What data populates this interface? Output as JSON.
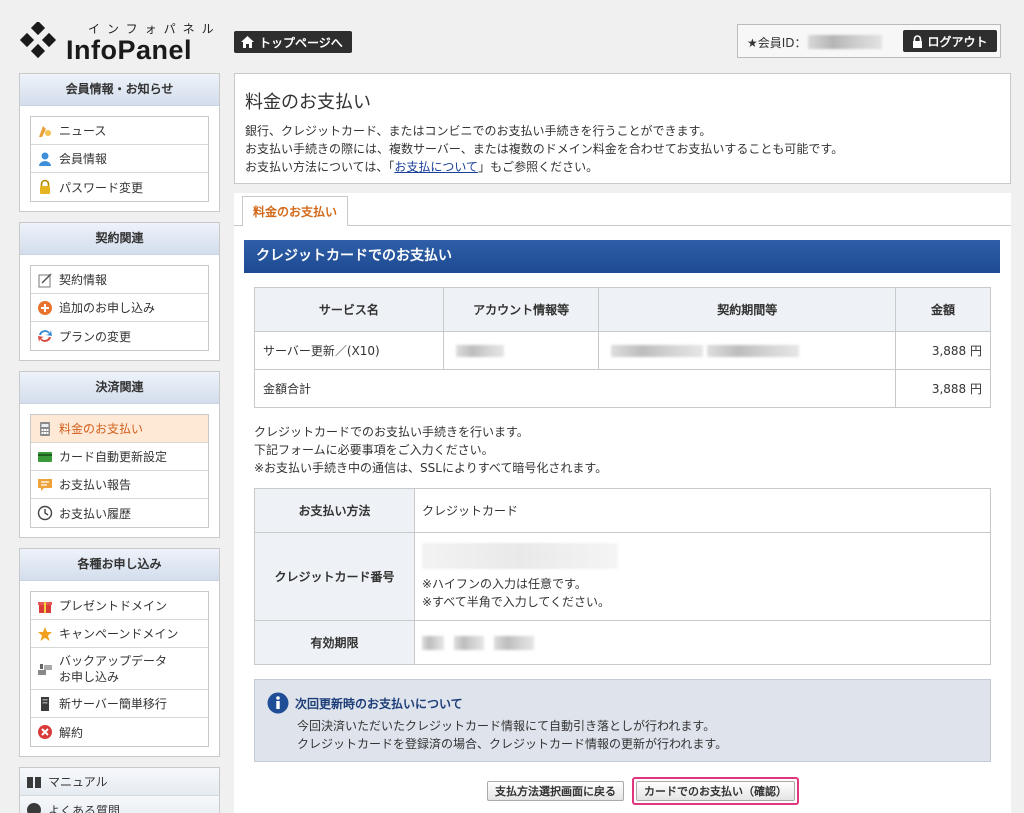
{
  "header": {
    "logo_kana": "インフォパネル",
    "logo_name": "InfoPanel",
    "top_page_button": "トップページへ",
    "member_id_label": "★会員ID：",
    "logout_button": "ログアウト"
  },
  "sidebar": {
    "sections": [
      {
        "title": "会員情報・お知らせ",
        "items": [
          {
            "label": "ニュース",
            "icon": "news-icon"
          },
          {
            "label": "会員情報",
            "icon": "user-icon"
          },
          {
            "label": "パスワード変更",
            "icon": "lock-icon"
          }
        ]
      },
      {
        "title": "契約関連",
        "items": [
          {
            "label": "契約情報",
            "icon": "contract-icon"
          },
          {
            "label": "追加のお申し込み",
            "icon": "add-icon"
          },
          {
            "label": "プランの変更",
            "icon": "change-icon"
          }
        ]
      },
      {
        "title": "決済関連",
        "items": [
          {
            "label": "料金のお支払い",
            "icon": "calculator-icon",
            "active": true
          },
          {
            "label": "カード自動更新設定",
            "icon": "card-icon"
          },
          {
            "label": "お支払い報告",
            "icon": "report-icon"
          },
          {
            "label": "お支払い履歴",
            "icon": "clock-icon"
          }
        ]
      },
      {
        "title": "各種お申し込み",
        "items": [
          {
            "label": "プレゼントドメイン",
            "icon": "gift-icon"
          },
          {
            "label": "キャンペーンドメイン",
            "icon": "star-icon"
          },
          {
            "label": "バックアップデータ お申し込み",
            "icon": "backup-icon"
          },
          {
            "label": "新サーバー簡単移行",
            "icon": "server-icon"
          },
          {
            "label": "解約",
            "icon": "cancel-icon"
          }
        ]
      }
    ],
    "bottom": [
      {
        "label": "マニュアル",
        "icon": "book-icon"
      },
      {
        "label": "よくある質問",
        "icon": "faq-icon"
      }
    ]
  },
  "intro": {
    "title": "料金のお支払い",
    "line1": "銀行、クレジットカード、またはコンビニでのお支払い手続きを行うことができます。",
    "line2": "お支払い手続きの際には、複数サーバー、または複数のドメイン料金を合わせてお支払いすることも可能です。",
    "line3_before": "お支払い方法については、「",
    "line3_link": "お支払について",
    "line3_after": "」もご参照ください。"
  },
  "tab": {
    "label": "料金のお支払い"
  },
  "section_title": "クレジットカードでのお支払い",
  "order_table": {
    "headers": [
      "サービス名",
      "アカウント情報等",
      "契約期間等",
      "金額"
    ],
    "rows": [
      {
        "service": "サーバー更新／(X10)",
        "amount": "3,888 円"
      }
    ],
    "total_label": "金額合計",
    "total_amount": "3,888 円"
  },
  "notes": [
    "クレジットカードでのお支払い手続きを行います。",
    "下記フォームに必要事項をご入力ください。",
    "※お支払い手続き中の通信は、SSLによりすべて暗号化されます。"
  ],
  "form": {
    "method_label": "お支払い方法",
    "method_value": "クレジットカード",
    "card_label": "クレジットカード番号",
    "card_hint1": "※ハイフンの入力は任意です。",
    "card_hint2": "※すべて半角で入力してください。",
    "expiry_label": "有効期限"
  },
  "info": {
    "title": "次回更新時のお支払いについて",
    "line1": "今回決済いただいたクレジットカード情報にて自動引き落としが行われます。",
    "line2": "クレジットカードを登録済の場合、クレジットカード情報の更新が行われます。"
  },
  "buttons": {
    "back": "支払方法選択画面に戻る",
    "confirm": "カードでのお支払い（確認）"
  }
}
